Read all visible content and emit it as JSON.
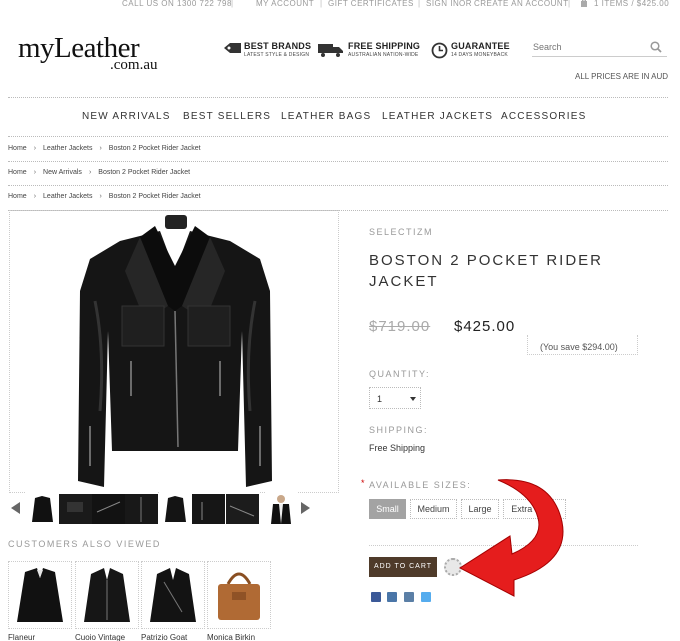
{
  "topbar": {
    "phone": "CALL US ON 1300 722 798",
    "my_account": "MY ACCOUNT",
    "gift": "GIFT CERTIFICATES",
    "sign_in": "SIGN IN",
    "or": "OR",
    "create": "CREATE AN ACCOUNT",
    "cart": "1 ITEMS / $425.00"
  },
  "logo": {
    "main": "myLeather",
    "sub": ".com.au"
  },
  "features": [
    {
      "title": "BEST BRANDS",
      "sub": "LATEST STYLE & DESIGN",
      "icon": "tag-icon"
    },
    {
      "title": "FREE SHIPPING",
      "sub": "AUSTRALIAN NATION-WIDE",
      "icon": "truck-icon"
    },
    {
      "title": "GUARANTEE",
      "sub": "14 DAYS MONEYBACK",
      "icon": "clock-icon"
    }
  ],
  "search": {
    "placeholder": "Search"
  },
  "prices_note": "ALL PRICES ARE IN AUD",
  "nav": [
    "NEW ARRIVALS",
    "BEST SELLERS",
    "LEATHER BAGS",
    "LEATHER JACKETS",
    "ACCESSORIES"
  ],
  "breadcrumbs": [
    [
      "Home",
      "Leather Jackets",
      "Boston 2 Pocket Rider Jacket"
    ],
    [
      "Home",
      "New Arrivals",
      "Boston 2 Pocket Rider Jacket"
    ],
    [
      "Home",
      "Leather Jackets",
      "Boston 2 Pocket Rider Jacket"
    ]
  ],
  "product": {
    "brand": "SELECTIZM",
    "title": "BOSTON 2 POCKET RIDER JACKET",
    "old_price": "$719.00",
    "new_price": "$425.00",
    "save": "(You save $294.00)",
    "quantity_label": "QUANTITY:",
    "quantity": "1",
    "shipping_label": "SHIPPING:",
    "shipping": "Free Shipping",
    "sizes_label": "AVAILABLE SIZES:",
    "required_mark": "*",
    "sizes": [
      "Small",
      "Medium",
      "Large",
      "Extra Large"
    ],
    "selected_size": "Small",
    "add_to_cart": "ADD TO CART"
  },
  "also_viewed": {
    "title": "CUSTOMERS ALSO VIEWED",
    "items": [
      "Flaneur",
      "Cuoio Vintage",
      "Patrizio Goat",
      "Monica Birkin"
    ]
  },
  "social_colors": [
    "#3b5998",
    "#4a76a8",
    "#5b7fa6",
    "#55acee"
  ]
}
